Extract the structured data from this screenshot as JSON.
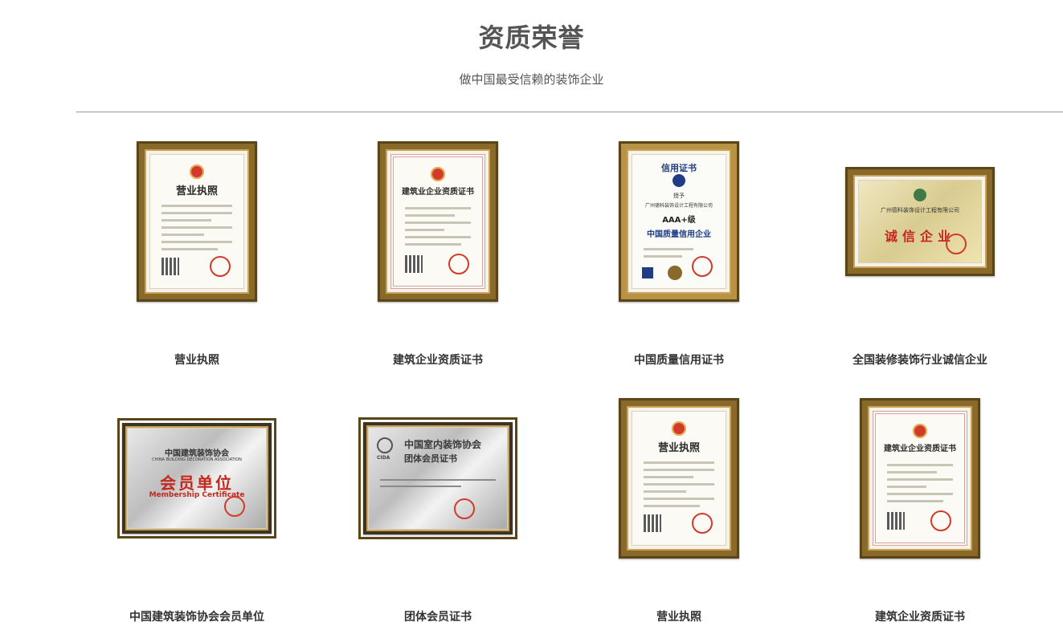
{
  "header": {
    "title": "资质荣誉",
    "subtitle": "做中国最受信赖的装饰企业"
  },
  "certificates": [
    {
      "caption": "营业执照",
      "orientation": "portrait",
      "style": "license",
      "doc_title": "营业执照",
      "icon": "national-emblem-icon"
    },
    {
      "caption": "建筑企业资质证书",
      "orientation": "portrait",
      "style": "qualification",
      "doc_title": "建筑业企业资质证书",
      "icon": "national-emblem-icon"
    },
    {
      "caption": "中国质量信用证书",
      "orientation": "portrait",
      "style": "credit",
      "doc_title": "信用证书",
      "body_lines": [
        "授予",
        "广州德科装饰设计工程有限公司",
        "AAA+级",
        "中国质量信用企业"
      ],
      "icon": "credit-logo-icon"
    },
    {
      "caption": "全国装修装饰行业诚信企业",
      "orientation": "landscape",
      "style": "honest",
      "body_lines": [
        "广州德科装饰设计工程有限公司",
        "诚信企业"
      ],
      "icon": "association-logo-icon"
    },
    {
      "caption": "中国建筑装饰协会会员单位",
      "orientation": "landscape",
      "style": "member",
      "body_lines": [
        "中国建筑装饰协会",
        "CHINA BUILDING DECORATION ASSOCIATION",
        "会员单位",
        "Membership Certificate"
      ],
      "icon": "association-plaque-icon"
    },
    {
      "caption": "团体会员证书",
      "orientation": "landscape",
      "style": "cida",
      "body_lines": [
        "中国室内装饰协会",
        "团体会员证书",
        "CIDA"
      ],
      "icon": "cida-logo-icon"
    },
    {
      "caption": "营业执照",
      "orientation": "portrait",
      "style": "license",
      "doc_title": "营业执照",
      "icon": "national-emblem-icon"
    },
    {
      "caption": "建筑企业资质证书",
      "orientation": "portrait",
      "style": "qualification",
      "doc_title": "建筑业企业资质证书",
      "icon": "national-emblem-icon"
    }
  ]
}
